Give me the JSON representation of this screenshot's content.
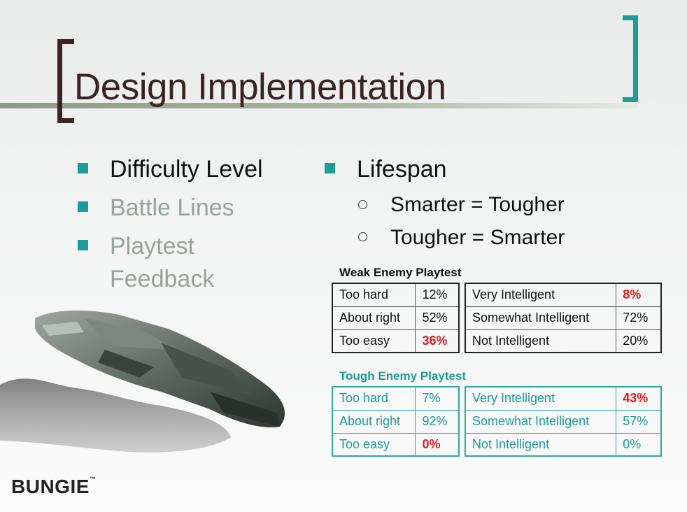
{
  "title": "Design Implementation",
  "left_bullets": [
    {
      "label": "Difficulty Level",
      "color": "#111111"
    },
    {
      "label": "Battle Lines",
      "color": "#97a39a"
    },
    {
      "label": "Playtest",
      "color": "#97a39a"
    },
    {
      "label": "Feedback",
      "color": "#97a39a"
    }
  ],
  "right_bullet": "Lifespan",
  "sub_bullets": [
    "Smarter = Tougher",
    "Tougher = Smarter"
  ],
  "weak": {
    "title": "Weak Enemy Playtest",
    "difficulty": [
      [
        "Too hard",
        "12%"
      ],
      [
        "About right",
        "52%"
      ],
      [
        "Too easy",
        "36%"
      ]
    ],
    "intelligence": [
      [
        "Very Intelligent",
        "8%"
      ],
      [
        "Somewhat Intelligent",
        "72%"
      ],
      [
        "Not Intelligent",
        "20%"
      ]
    ]
  },
  "tough": {
    "title": "Tough Enemy Playtest",
    "difficulty": [
      [
        "Too hard",
        "7%"
      ],
      [
        "About right",
        "92%"
      ],
      [
        "Too easy",
        "0%"
      ]
    ],
    "intelligence": [
      [
        "Very Intelligent",
        "43%"
      ],
      [
        "Somewhat Intelligent",
        "57%"
      ],
      [
        "Not Intelligent",
        "0%"
      ]
    ]
  },
  "logo": "BUNGIE",
  "logo_tm": "™",
  "colors": {
    "accent": "#1e9b96",
    "title": "#3b2323",
    "highlight": "#e41b1b"
  }
}
